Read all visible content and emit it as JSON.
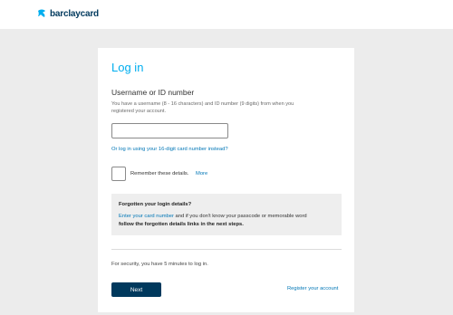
{
  "header": {
    "brand": "barclaycard"
  },
  "form": {
    "title": "Log in",
    "username_label": "Username or ID number",
    "hint": "You have a username (8 - 16 characters) and ID number (9 digits) from when you registered your account.",
    "username_value": "",
    "alt_login_link": "Or log in using your 16-digit card number instead?",
    "remember_label": "Remember these details.",
    "remember_more": "More",
    "forgotten": {
      "title": "Forgotten your login details?",
      "link": "Enter your card number",
      "line1_rest": " and if you don't know your passcode or memorable word",
      "line2": "follow the forgotten details links in the next steps."
    },
    "security_note": "For security, you have 5 minutes to log in.",
    "next_button": "Next",
    "register_link": "Register your account"
  },
  "colors": {
    "brand_navy": "#00395d",
    "brand_blue": "#00aeef",
    "link_blue": "#0076b6",
    "page_bg": "#ececec"
  },
  "icons": {
    "logo": "barclays-eagle-icon"
  }
}
